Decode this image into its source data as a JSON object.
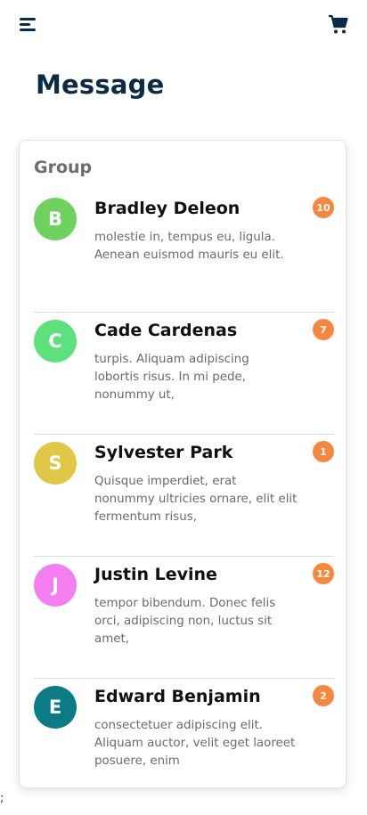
{
  "header": {
    "menu_icon": "hamburger-menu-icon",
    "cart_icon": "shopping-cart-icon",
    "icon_color": "#0d2a44"
  },
  "page": {
    "title": "Message"
  },
  "card": {
    "group_title": "Group",
    "messages": [
      {
        "initial": "B",
        "name": "Bradley Deleon",
        "text": "molestie in, tempus eu, ligula. Aenean euismod mauris eu elit.",
        "count": "10",
        "avatar_color": "#6fd25e"
      },
      {
        "initial": "C",
        "name": "Cade Cardenas",
        "text": "turpis. Aliquam adipiscing lobortis risus. In mi pede, nonummy ut,",
        "count": "7",
        "avatar_color": "#5ee07d"
      },
      {
        "initial": "S",
        "name": "Sylvester Park",
        "text": "Quisque imperdiet, erat nonummy ultricies ornare, elit elit fermentum risus,",
        "count": "1",
        "avatar_color": "#dfc847"
      },
      {
        "initial": "J",
        "name": "Justin Levine",
        "text": "tempor bibendum. Donec felis orci, adipiscing non, luctus sit amet,",
        "count": "12",
        "avatar_color": "#f47ef0"
      },
      {
        "initial": "E",
        "name": "Edward Benjamin",
        "text": "consectetuer adipiscing elit. Aliquam auctor, velit eget laoreet posuere, enim",
        "count": "2",
        "avatar_color": "#0b7b85"
      }
    ]
  },
  "badge_color": "#f6873e",
  "stray_text": ";"
}
